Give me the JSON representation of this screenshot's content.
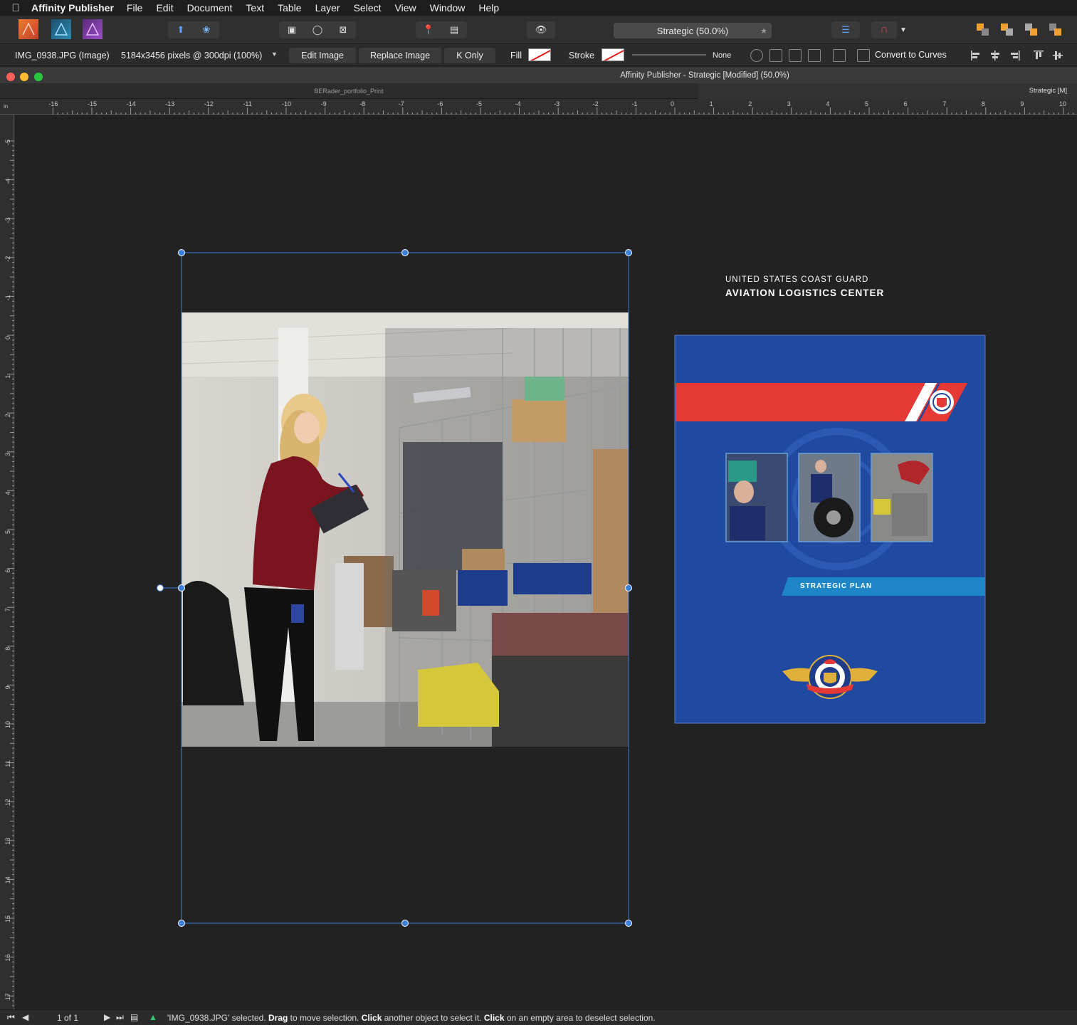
{
  "menubar": {
    "app_name": "Affinity Publisher",
    "items": [
      "File",
      "Edit",
      "Document",
      "Text",
      "Table",
      "Layer",
      "Select",
      "View",
      "Window",
      "Help"
    ]
  },
  "toolbar": {
    "document_selector": "Strategic (50.0%)"
  },
  "context": {
    "object_name": "IMG_0938.JPG (Image)",
    "image_info": "5184x3456 pixels @ 300dpi (100%)",
    "edit_image": "Edit Image",
    "replace_image": "Replace Image",
    "k_only": "K Only",
    "fill_label": "Fill",
    "stroke_label": "Stroke",
    "stroke_width": "None",
    "convert_to_curves": "Convert to Curves"
  },
  "window": {
    "title": "Affinity Publisher - Strategic [Modified] (50.0%)",
    "tabs": [
      "BERader_portfolio_Print",
      "Strategic [M]"
    ]
  },
  "rulers": {
    "unit": "in",
    "top_ticks": [
      "-16",
      "-15",
      "-14",
      "-13",
      "-12",
      "-11",
      "-10",
      "-9",
      "-8",
      "-7",
      "-6",
      "-5",
      "-4",
      "-3",
      "-2",
      "-1",
      "0",
      "1",
      "2",
      "3",
      "4",
      "5",
      "6",
      "7",
      "8",
      "9",
      "10"
    ],
    "left_ticks": [
      "-5",
      "-4",
      "-3",
      "-2",
      "-1",
      "0",
      "1",
      "2",
      "3",
      "4",
      "5",
      "6",
      "7",
      "8",
      "9",
      "10",
      "11",
      "12",
      "13",
      "14",
      "15",
      "16",
      "17"
    ]
  },
  "cover": {
    "line1": "UNITED STATES COAST GUARD",
    "line2": "AVIATION LOGISTICS CENTER",
    "subtitle": "STRATEGIC PLAN",
    "colors": {
      "background": "#1f4aa0",
      "banner": "#e53935",
      "subtitle_band": "#1e86c6"
    }
  },
  "status": {
    "page": "1 of 1",
    "message_parts": [
      {
        "text": "'IMG_0938.JPG' selected. ",
        "bold": false
      },
      {
        "text": "Drag",
        "bold": true
      },
      {
        "text": " to move selection. ",
        "bold": false
      },
      {
        "text": "Click",
        "bold": true
      },
      {
        "text": " another object to select it. ",
        "bold": false
      },
      {
        "text": "Click",
        "bold": true
      },
      {
        "text": " on an empty area to deselect selection.",
        "bold": false
      }
    ]
  }
}
